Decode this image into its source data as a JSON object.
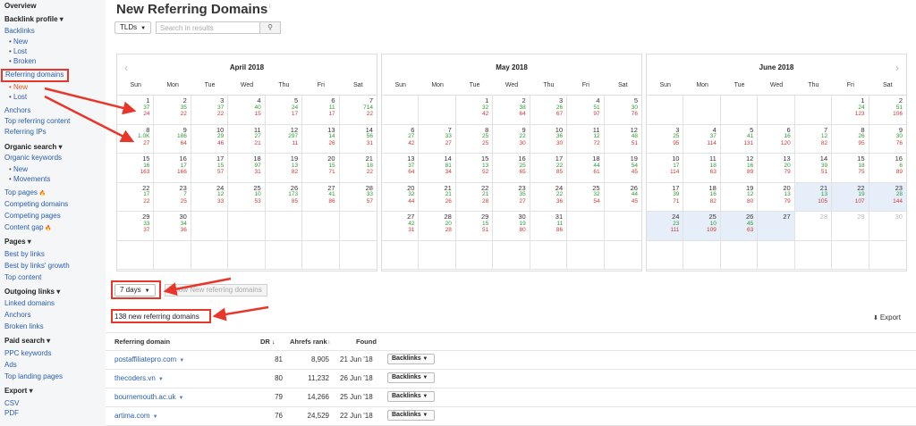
{
  "sidebar": {
    "overview": "Overview",
    "backlink_profile": "Backlink profile",
    "backlinks": "Backlinks",
    "backlinks_new": "New",
    "backlinks_lost": "Lost",
    "backlinks_broken": "Broken",
    "referring_domains": "Referring domains",
    "rd_new": "New",
    "rd_lost": "Lost",
    "anchors": "Anchors",
    "top_referring_content": "Top referring content",
    "referring_ips": "Referring IPs",
    "organic_search": "Organic search",
    "organic_keywords": "Organic keywords",
    "ok_new": "New",
    "ok_movements": "Movements",
    "top_pages": "Top pages",
    "competing_domains": "Competing domains",
    "competing_pages": "Competing pages",
    "content_gap": "Content gap",
    "pages": "Pages",
    "best_by_links": "Best by links",
    "best_by_links_growth": "Best by links' growth",
    "top_content": "Top content",
    "outgoing_links": "Outgoing links",
    "linked_domains": "Linked domains",
    "anchors2": "Anchors",
    "broken_links": "Broken links",
    "paid_search": "Paid search",
    "ppc_keywords": "PPC keywords",
    "ads": "Ads",
    "top_landing_pages": "Top landing pages",
    "export": "Export",
    "csv": "CSV",
    "pdf": "PDF"
  },
  "header": {
    "title": "New Referring Domains",
    "title_suffix": "i"
  },
  "filters": {
    "tlds": "TLDs",
    "search_placeholder": "Search in results",
    "period": "7 days",
    "show_button": "Show New referring domains"
  },
  "weekdays": [
    "Sun",
    "Mon",
    "Tue",
    "Wed",
    "Thu",
    "Fri",
    "Sat"
  ],
  "calendars": [
    {
      "month": "April 2018",
      "offset": 0,
      "days": [
        [
          "1",
          "37",
          "24"
        ],
        [
          "2",
          "35",
          "22"
        ],
        [
          "3",
          "37",
          "22"
        ],
        [
          "4",
          "40",
          "15"
        ],
        [
          "5",
          "24",
          "17"
        ],
        [
          "6",
          "11",
          "17"
        ],
        [
          "7",
          "714",
          "22"
        ],
        [
          "8",
          "1.0K",
          "27"
        ],
        [
          "9",
          "186",
          "64"
        ],
        [
          "10",
          "29",
          "46"
        ],
        [
          "11",
          "27",
          "21"
        ],
        [
          "12",
          "297",
          "11"
        ],
        [
          "13",
          "14",
          "26"
        ],
        [
          "14",
          "56",
          "31"
        ],
        [
          "15",
          "16",
          "163"
        ],
        [
          "16",
          "17",
          "166"
        ],
        [
          "17",
          "15",
          "57"
        ],
        [
          "18",
          "97",
          "31"
        ],
        [
          "19",
          "13",
          "82"
        ],
        [
          "20",
          "15",
          "71"
        ],
        [
          "21",
          "18",
          "22"
        ],
        [
          "22",
          "17",
          "22"
        ],
        [
          "23",
          "7",
          "25"
        ],
        [
          "24",
          "12",
          "33"
        ],
        [
          "25",
          "10",
          "53"
        ],
        [
          "26",
          "173",
          "85"
        ],
        [
          "27",
          "41",
          "86"
        ],
        [
          "28",
          "33",
          "57"
        ],
        [
          "29",
          "33",
          "37"
        ],
        [
          "30",
          "34",
          "36"
        ]
      ]
    },
    {
      "month": "May 2018",
      "offset": 2,
      "days": [
        [
          "1",
          "32",
          "42"
        ],
        [
          "2",
          "38",
          "64"
        ],
        [
          "3",
          "26",
          "67"
        ],
        [
          "4",
          "51",
          "97"
        ],
        [
          "5",
          "30",
          "76"
        ],
        [
          "6",
          "27",
          "42"
        ],
        [
          "7",
          "33",
          "27"
        ],
        [
          "8",
          "25",
          "25"
        ],
        [
          "9",
          "22",
          "30"
        ],
        [
          "10",
          "36",
          "30"
        ],
        [
          "11",
          "12",
          "72"
        ],
        [
          "12",
          "48",
          "51"
        ],
        [
          "13",
          "37",
          "64"
        ],
        [
          "14",
          "81",
          "34"
        ],
        [
          "15",
          "13",
          "52"
        ],
        [
          "16",
          "25",
          "65"
        ],
        [
          "17",
          "22",
          "85"
        ],
        [
          "18",
          "44",
          "61"
        ],
        [
          "19",
          "54",
          "45"
        ],
        [
          "20",
          "32",
          "44"
        ],
        [
          "21",
          "21",
          "26"
        ],
        [
          "22",
          "21",
          "28"
        ],
        [
          "23",
          "35",
          "27"
        ],
        [
          "24",
          "22",
          "36"
        ],
        [
          "25",
          "32",
          "54"
        ],
        [
          "26",
          "44",
          "45"
        ],
        [
          "27",
          "42",
          "31"
        ],
        [
          "28",
          "20",
          "28"
        ],
        [
          "29",
          "15",
          "51"
        ],
        [
          "30",
          "19",
          "80"
        ],
        [
          "31",
          "11",
          "86"
        ]
      ]
    },
    {
      "month": "June 2018",
      "offset": 5,
      "days": [
        [
          "1",
          "24",
          "123"
        ],
        [
          "2",
          "51",
          "106"
        ],
        [
          "3",
          "25",
          "95"
        ],
        [
          "4",
          "37",
          "114"
        ],
        [
          "5",
          "41",
          "131"
        ],
        [
          "6",
          "16",
          "120"
        ],
        [
          "7",
          "12",
          "82"
        ],
        [
          "8",
          "26",
          "95"
        ],
        [
          "9",
          "30",
          "76"
        ],
        [
          "10",
          "17",
          "114"
        ],
        [
          "11",
          "18",
          "63"
        ],
        [
          "12",
          "16",
          "89"
        ],
        [
          "13",
          "20",
          "79"
        ],
        [
          "14",
          "39",
          "51"
        ],
        [
          "15",
          "18",
          "75"
        ],
        [
          "16",
          "6",
          "89"
        ],
        [
          "17",
          "39",
          "71"
        ],
        [
          "18",
          "16",
          "82"
        ],
        [
          "19",
          "12",
          "80"
        ],
        [
          "20",
          "13",
          "79"
        ],
        [
          "21",
          "13",
          "105"
        ],
        [
          "22",
          "19",
          "107"
        ],
        [
          "23",
          "28",
          "144"
        ],
        [
          "24",
          "23",
          "111"
        ],
        [
          "25",
          "10",
          "109"
        ],
        [
          "26",
          "45",
          "63"
        ],
        [
          "27",
          "",
          ""
        ],
        [
          "28",
          "",
          ""
        ],
        [
          "29",
          "",
          ""
        ],
        [
          "30",
          "",
          ""
        ]
      ]
    }
  ],
  "results": {
    "count": "138 new referring domains",
    "export": "Export"
  },
  "table": {
    "headers": {
      "domain": "Referring domain",
      "dr": "DR",
      "ahrefs_rank": "Ahrefs rank",
      "found": "Found"
    },
    "rows": [
      {
        "domain": "postaffiliatepro.com",
        "dr": "81",
        "rank": "8,905",
        "found": "21 Jun '18",
        "btn": "Backlinks"
      },
      {
        "domain": "thecoders.vn",
        "dr": "80",
        "rank": "11,232",
        "found": "26 Jun '18",
        "btn": "Backlinks"
      },
      {
        "domain": "bournemouth.ac.uk",
        "dr": "79",
        "rank": "14,266",
        "found": "25 Jun '18",
        "btn": "Backlinks"
      },
      {
        "domain": "artima.com",
        "dr": "76",
        "rank": "24,529",
        "found": "22 Jun '18",
        "btn": "Backlinks"
      }
    ]
  },
  "colors": {
    "accent": "#e8362a",
    "link": "#2a5db0",
    "gain": "#2c9c2c",
    "loss": "#d03838",
    "selected": "#e6eefa"
  }
}
